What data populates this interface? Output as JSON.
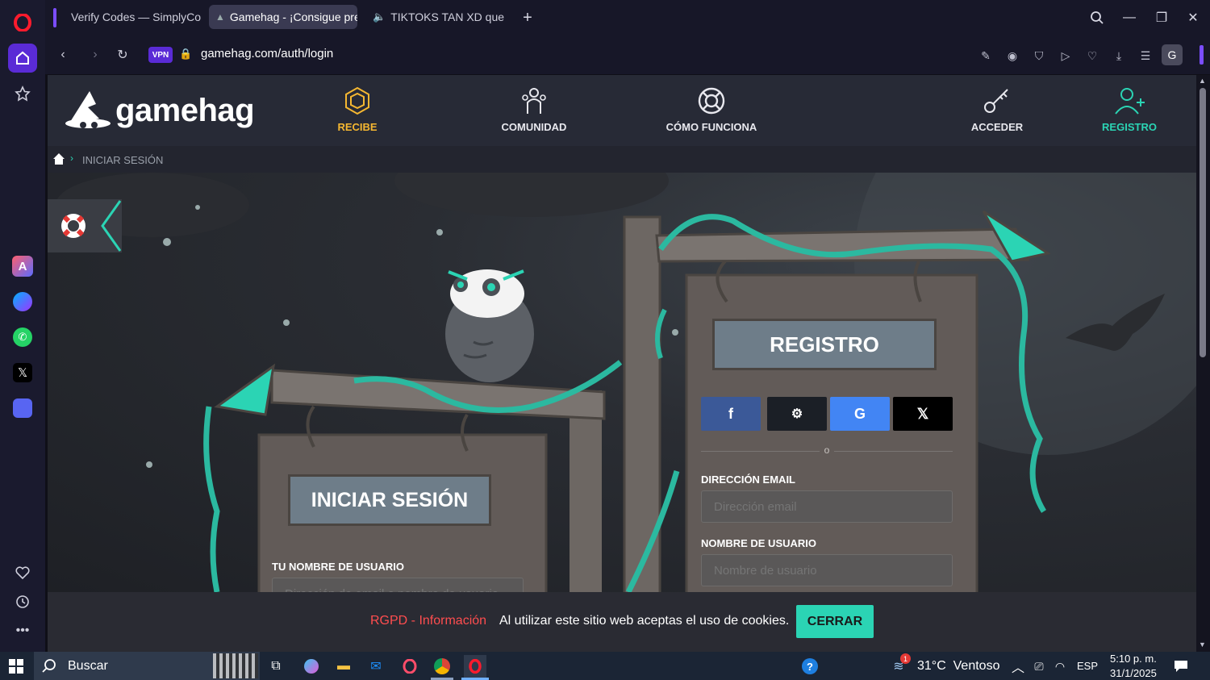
{
  "browser": {
    "tabs": [
      {
        "title": "Verify Codes — SimplyCo",
        "active": false
      },
      {
        "title": "Gamehag - ¡Consigue pre",
        "active": true
      },
      {
        "title": "TIKTOKS TAN XD que",
        "active": false
      }
    ],
    "vpn_label": "VPN",
    "url": "gamehag.com/auth/login",
    "profile_initial": "G",
    "accent_color": "#7b4dff"
  },
  "site": {
    "logo_text": "gamehag",
    "nav": {
      "recibe": "RECIBE",
      "comunidad": "COMUNIDAD",
      "como_funciona": "CÓMO FUNCIONA",
      "acceder": "ACCEDER",
      "registro": "REGISTRO"
    },
    "breadcrumb": "INICIAR SESIÓN",
    "brand_color": "#2bd4b4",
    "gold_color": "#f5b731"
  },
  "login": {
    "title": "INICIAR SESIÓN",
    "username_label": "TU NOMBRE DE USUARIO",
    "username_placeholder": "Dirección de email o nombre de usuario"
  },
  "register": {
    "title": "REGISTRO",
    "divider": "o",
    "email_label": "DIRECCIÓN EMAIL",
    "email_placeholder": "Dirección email",
    "username_label": "NOMBRE DE USUARIO",
    "username_placeholder": "Nombre de usuario"
  },
  "cookies": {
    "link": "RGPD - Información",
    "text": "Al utilizar este sitio web aceptas el uso de cookies.",
    "button": "CERRAR"
  },
  "taskbar": {
    "search_placeholder": "Buscar",
    "weather": "31°C  Ventoso",
    "weather_badge": "1",
    "language": "ESP",
    "time": "5:10 p. m.",
    "date": "31/1/2025"
  }
}
